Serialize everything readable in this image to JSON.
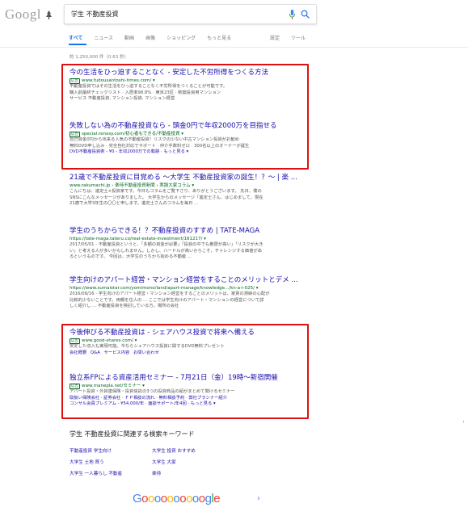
{
  "logo": "Googl",
  "search": {
    "query": "学生 不動産投資"
  },
  "tabs": [
    "すべて",
    "ニュース",
    "動画",
    "画像",
    "ショッピング",
    "もっと見る"
  ],
  "tools": [
    "設定",
    "ツール"
  ],
  "result_stats": "約 1,250,000 件（0.63 秒）",
  "ads_top": [
    {
      "title": "今の生活をひっ迫することなく - 安定した不労所得をつくる方法",
      "badge": "広告",
      "url": "www.fudousantoshi-times.com/ ▾",
      "lines": [
        "不動産投資ではその生活をひっ迫することなく不労所得をつくることが可能です。",
        "購入前最終チェックリスト · 入居率98.8% · 東京23区 · 新築投資用マンション",
        "サービス 不動産投資, マンション投資, マンション経営"
      ]
    },
    {
      "title": "失敗しない為の不動産投資なら - 頭金0円で年収2000万を目指せる",
      "badge": "広告",
      "url": "special.renosy.com/初心者もできる/不動産投資 ▾",
      "lines": [
        "自己資金0円から出来る人気の不動産投資！リスクの少ない中古マンション投資がお勧め",
        "無料DVD申し込み · 完全自社対応でサポート · 仲介手数料ゼロ · 300名以上のオーナーが誕生"
      ],
      "sitelinks": "DVD不動産投資術 - ¥0 - 年収2000万での軌跡 · もっと見る ▾"
    }
  ],
  "organic": [
    {
      "title": "21歳で不動産投資に目覚める 〜大学生 不動産投資家の誕生！？〜 | 楽 ...",
      "url": "www.rakumachi.jp › 楽待不動産投資新聞 › 実践大家コラム ▾",
      "lines": [
        "こんにちは、進定士×投資家です。今日もコラムをご覧下さり、ありがとうございます。 先日、僕の",
        "SNSにこんなメッセージがありました。 大学生からのメッセージ「進定士さん、はじめまして。現在",
        "21歳で大学3年生の〇〇と申します。進定士さんのコラムを毎日 ..."
      ]
    },
    {
      "title": "学生のうちからできる！？不動産投資のすすめ | TATE-MAGA",
      "url": "https://tate-maga.tateru.co/real-estate-investment/161217/ ▾",
      "lines": [
        "2017/05/01 - 不動産投資というと、「多額の資金が必要」「投資の中でも敷居が高い」「リスクが大き",
        "い」と考える人が多いかもしれません。しかし、ハードルが高いからこそ、チャレンジする価値があ",
        "るというものです。 今回は、大学生のうちから始める不動産 ..."
      ]
    },
    {
      "title": "学生向けのアパート経営・マンション経営をすることのメリットとデメ ...",
      "url": "https://www.sumaistar.com/yomimono/land/apart-manage/knowledge.../kn-a-l-025/ ▾",
      "lines": [
        "2016/08/16 - 学生向けのアパート経営・マンション経営をすることのメリットは、家賃の滞納の心配が",
        "比較的少ないことです。両親を住人の ... ここでは学生向けのアパート・マンションの経営について詳",
        "しく紹介し ... 不動産投資を検討している方。場所の会社"
      ]
    }
  ],
  "ads_bottom": [
    {
      "title": "今後伸びる不動産投資は - シェアハウス投資で将来へ備える",
      "badge": "広告",
      "url": "www.good-shares.com/ ▾",
      "lines": [
        "安定した収入も実現可能。今ならシェアハウス投資に関するDVD無料プレゼント"
      ],
      "sitelinks": [
        "会社概要",
        "Q&A",
        "サービス内容",
        "お問い合わせ"
      ]
    },
    {
      "title": "独立系FPによる資産活用セミナー - 7月21日（金）19時〜新宿開催",
      "badge": "広告",
      "url": "www.manepla.net/セミナー ▾",
      "lines": [
        "アパート投資・外資建保険・投資信託の3つの投資商品の紹がまとめて聞けるセミナー"
      ],
      "sitelinks": [
        "取扱い保険会社 · 証券会社 · ＦＰ相談の流れ · 無料相談予約 · 弊社プランナー紹介"
      ],
      "extra": "コンサル会員プレミアム - ¥54,000/年 · 面談サポート/年4回 · もっと見る ▾"
    }
  ],
  "related": {
    "heading": "学生 不動産投資に関連する検索キーワード",
    "left": [
      "不動産投資 学生向け",
      "大学生 土地 買う",
      "大学生 一人暮らし 不動産"
    ],
    "right": [
      "大学生 投資 おすすめ",
      "大学生 大家",
      "楽待"
    ]
  },
  "pager": {
    "next": "›"
  }
}
